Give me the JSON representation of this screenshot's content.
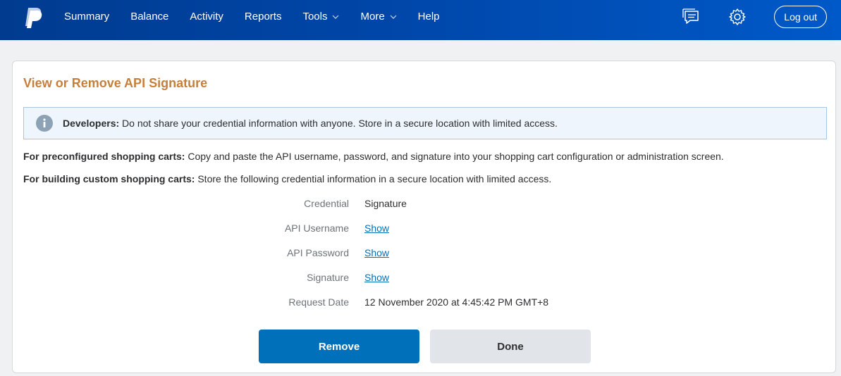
{
  "nav": {
    "items": [
      {
        "label": "Summary"
      },
      {
        "label": "Balance"
      },
      {
        "label": "Activity"
      },
      {
        "label": "Reports"
      },
      {
        "label": "Tools",
        "dropdown": true
      },
      {
        "label": "More",
        "dropdown": true
      },
      {
        "label": "Help"
      }
    ],
    "logout_label": "Log out",
    "icons": [
      "paypal-logo",
      "message-center-icon",
      "gear-icon",
      "chevron-down-icon"
    ]
  },
  "page": {
    "title": "View or Remove API Signature",
    "notice": {
      "prefix": "Developers:",
      "text": " Do not share your credential information with anyone. Store in a secure location with limited access."
    },
    "para1": {
      "prefix": "For preconfigured shopping carts:",
      "text": " Copy and paste the API username, password, and signature into your shopping cart configuration or administration screen."
    },
    "para2": {
      "prefix": "For building custom shopping carts:",
      "text": " Store the following credential information in a secure location with limited access."
    }
  },
  "credentials": {
    "credential": {
      "label": "Credential",
      "value": "Signature"
    },
    "api_username": {
      "label": "API Username",
      "link": "Show"
    },
    "api_password": {
      "label": "API Password",
      "link": "Show"
    },
    "signature": {
      "label": "Signature",
      "link": "Show"
    },
    "request_date": {
      "label": "Request Date",
      "value": "12 November 2020 at 4:45:42 PM GMT+8"
    }
  },
  "actions": {
    "remove_label": "Remove",
    "done_label": "Done"
  },
  "colors": {
    "nav_bg": "#0046a8",
    "title": "#c57f3b",
    "link": "#0070ba",
    "primary_button": "#0070ba",
    "secondary_button": "#e1e4e8",
    "notice_bg": "#eef5fc"
  }
}
